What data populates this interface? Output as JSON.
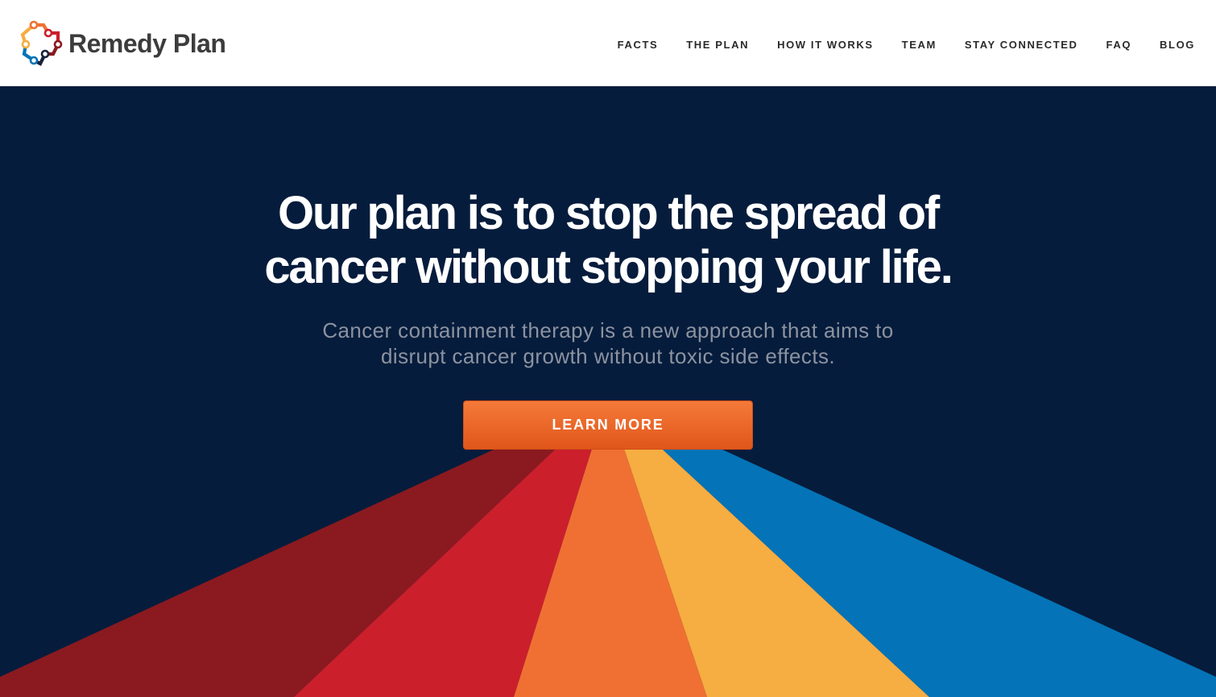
{
  "brand": {
    "name": "Remedy Plan",
    "logo_icon": "remedy-plan-ring-logo"
  },
  "nav": {
    "items": [
      {
        "label": "FACTS"
      },
      {
        "label": "THE PLAN"
      },
      {
        "label": "HOW IT WORKS"
      },
      {
        "label": "TEAM"
      },
      {
        "label": "STAY CONNECTED"
      },
      {
        "label": "FAQ"
      },
      {
        "label": "BLOG"
      }
    ]
  },
  "hero": {
    "headline_line1": "Our plan is to stop the spread of",
    "headline_line2": "cancer without stopping your life.",
    "subhead_line1": "Cancer containment therapy is a new approach that aims to",
    "subhead_line2": "disrupt cancer growth without toxic side effects.",
    "cta_label": "LEARN MORE"
  },
  "colors": {
    "header_bg": "#ffffff",
    "hero_bg": "#061c3c",
    "ray_dark_red": "#8a1a20",
    "ray_red": "#cb1f2c",
    "ray_orange": "#f07033",
    "ray_yellow": "#f6ad41",
    "ray_blue": "#0473b7",
    "cta": "#ea6426"
  }
}
